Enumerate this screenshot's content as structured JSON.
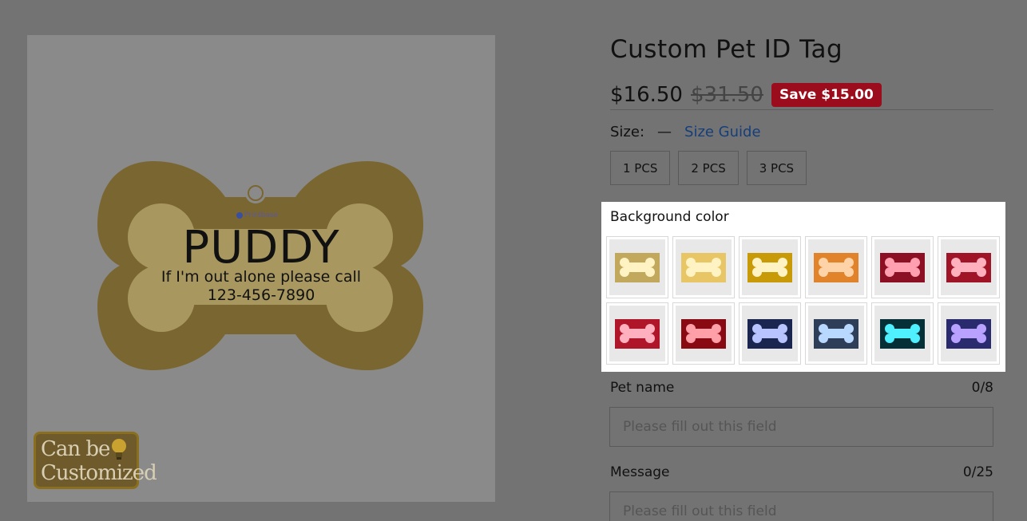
{
  "product_image": {
    "pet_name": "PUDDY",
    "message_line": "If I'm out alone please call",
    "phone_line": "123-456-7890",
    "brand": "Printbase",
    "badge_line1": "Can be",
    "badge_line2": "Customized",
    "tag_color": "#7a6630",
    "bone_inner_color": "#a89860"
  },
  "product": {
    "title": "Custom Pet ID Tag",
    "price_now": "$16.50",
    "price_was": "$31.50",
    "save_badge": "Save $15.00"
  },
  "size": {
    "label": "Size:",
    "dash": "—",
    "guide_link": "Size Guide",
    "options": [
      "1 PCS",
      "2 PCS",
      "3 PCS"
    ]
  },
  "background_color": {
    "label": "Background color",
    "swatches": [
      {
        "bg": "#c2a85c",
        "bone": "#fff3c4"
      },
      {
        "bg": "#e8c665",
        "bone": "#fff3c4"
      },
      {
        "bg": "#c99a08",
        "bone": "#fff3c4"
      },
      {
        "bg": "#e0832a",
        "bone": "#ffd3a8"
      },
      {
        "bg": "#8c1024",
        "bone": "#ff9fb0"
      },
      {
        "bg": "#a01428",
        "bone": "#ffb0be"
      },
      {
        "bg": "#b0162a",
        "bone": "#ffb0be"
      },
      {
        "bg": "#8a0a14",
        "bone": "#ff9fa8"
      },
      {
        "bg": "#1a2550",
        "bone": "#b8c4ff"
      },
      {
        "bg": "#2e3e58",
        "bone": "#b8d8ff"
      },
      {
        "bg": "#063038",
        "bone": "#4ff0ff"
      },
      {
        "bg": "#2a2a6e",
        "bone": "#b9a2ff"
      }
    ]
  },
  "pet_name_field": {
    "label": "Pet name",
    "count": "0/8",
    "placeholder": "Please fill out this field"
  },
  "message_field": {
    "label": "Message",
    "count": "0/25",
    "placeholder": "Please fill out this field"
  }
}
